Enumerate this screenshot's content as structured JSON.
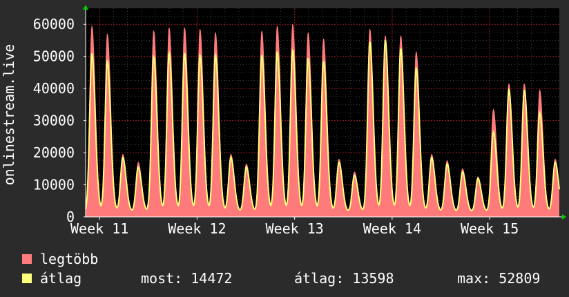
{
  "chart_data": {
    "type": "area",
    "title": "",
    "ylabel": "onlinestream.live",
    "xlabel": "",
    "ylim": [
      0,
      65000
    ],
    "yticks": [
      0,
      10000,
      20000,
      30000,
      40000,
      50000,
      60000
    ],
    "ytick_labels": [
      "0",
      "10000",
      "20000",
      "30000",
      "40000",
      "50000",
      "60000"
    ],
    "xticks": [
      "Week 11",
      "Week 12",
      "Week 13",
      "Week 14",
      "Week 15"
    ],
    "grid": true,
    "days": 34,
    "series": [
      {
        "name": "legtöbb",
        "color": "#ff7b7b",
        "daily_peaks": [
          58000,
          55500,
          18000,
          15500,
          56500,
          57500,
          57500,
          57000,
          56000,
          18000,
          15000,
          56500,
          58000,
          58500,
          56000,
          54000,
          16500,
          12500,
          57000,
          55000,
          55000,
          50000,
          18000,
          16000,
          13500,
          11000,
          32000,
          40000,
          40000,
          38000,
          16500
        ]
      },
      {
        "name": "átlag",
        "color": "#ffff7b",
        "daily_peaks": [
          49500,
          47000,
          17000,
          14000,
          48500,
          49500,
          49500,
          49000,
          49000,
          17000,
          14000,
          49000,
          50000,
          50500,
          48000,
          47000,
          15500,
          11500,
          53000,
          53500,
          51000,
          45000,
          17000,
          15000,
          12500,
          10500,
          25000,
          38000,
          38000,
          31000,
          15500
        ]
      }
    ]
  },
  "legend": {
    "items": [
      {
        "label": "legtöbb",
        "color": "#ff7b7b"
      },
      {
        "label": "átlag",
        "color": "#ffff7b"
      }
    ],
    "stats": {
      "now_label": "most:",
      "now_value": "14472",
      "avg_label": "átlag:",
      "avg_value": "13598",
      "max_label": "max:",
      "max_value": "52809"
    }
  }
}
